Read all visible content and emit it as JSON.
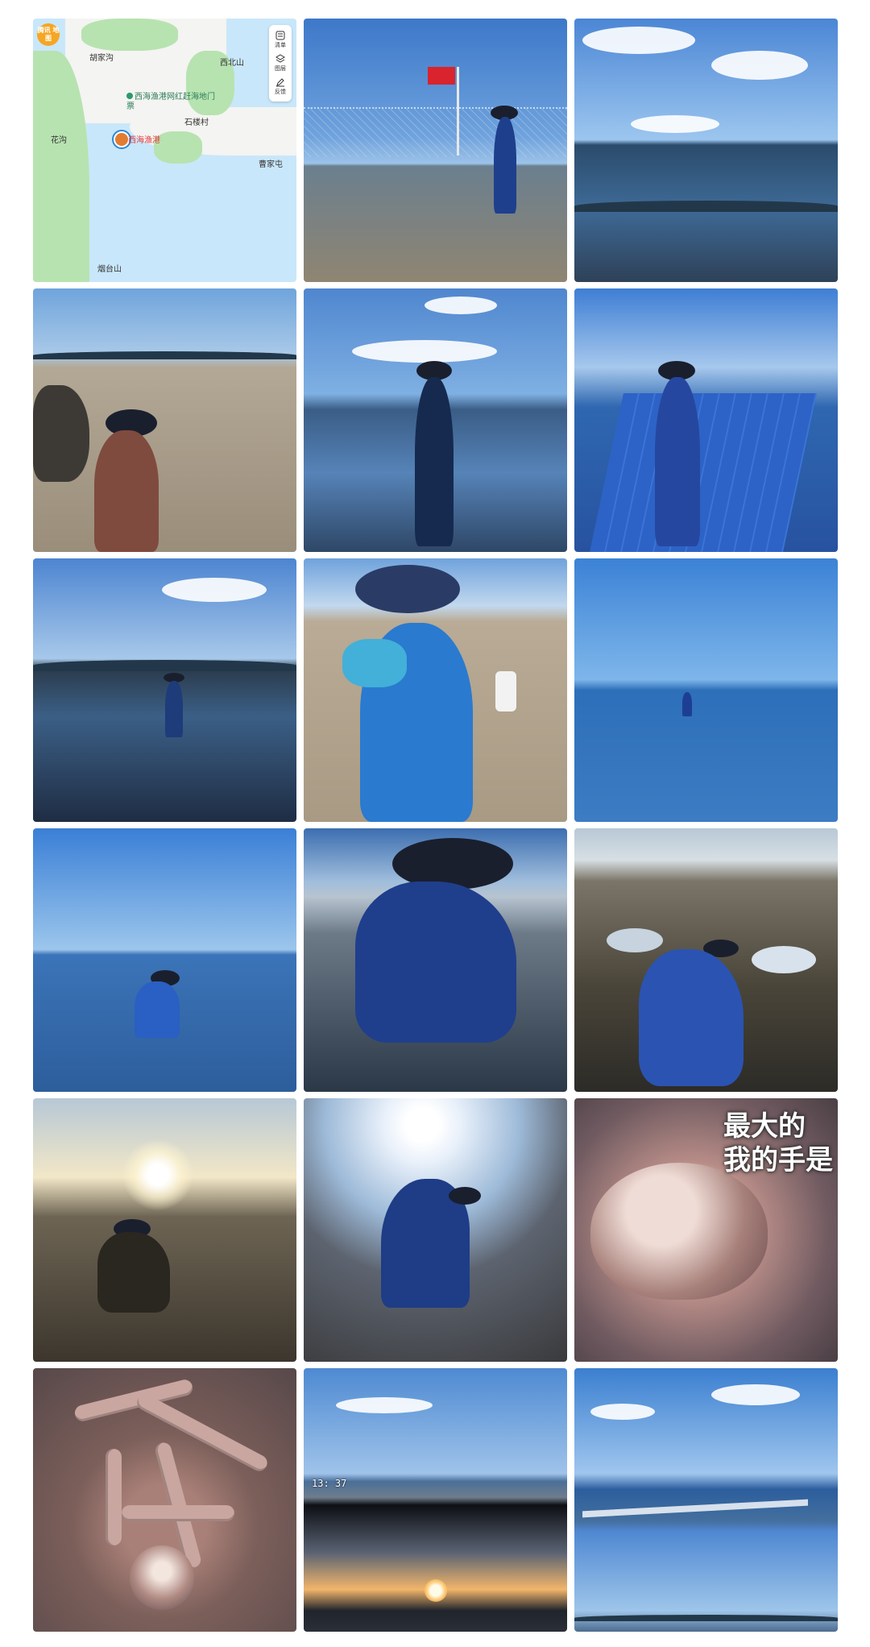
{
  "map": {
    "logo_text": "腾讯\n地图",
    "labels": [
      "胡家沟",
      "西北山",
      "石楼村",
      "花沟",
      "曹家屯",
      "烟台山"
    ],
    "poi_label": "西海渔港网红赶海地门票",
    "location_label": "西海渔港",
    "toolbar": [
      {
        "label": "清单",
        "icon": "list-icon"
      },
      {
        "label": "图层",
        "icon": "layers-icon"
      },
      {
        "label": "反馈",
        "icon": "pen-icon"
      }
    ]
  },
  "overlays": {
    "clam_caption_line1": "最大的",
    "clam_caption_line2": "我的手是",
    "timestamp": "13: 37"
  }
}
